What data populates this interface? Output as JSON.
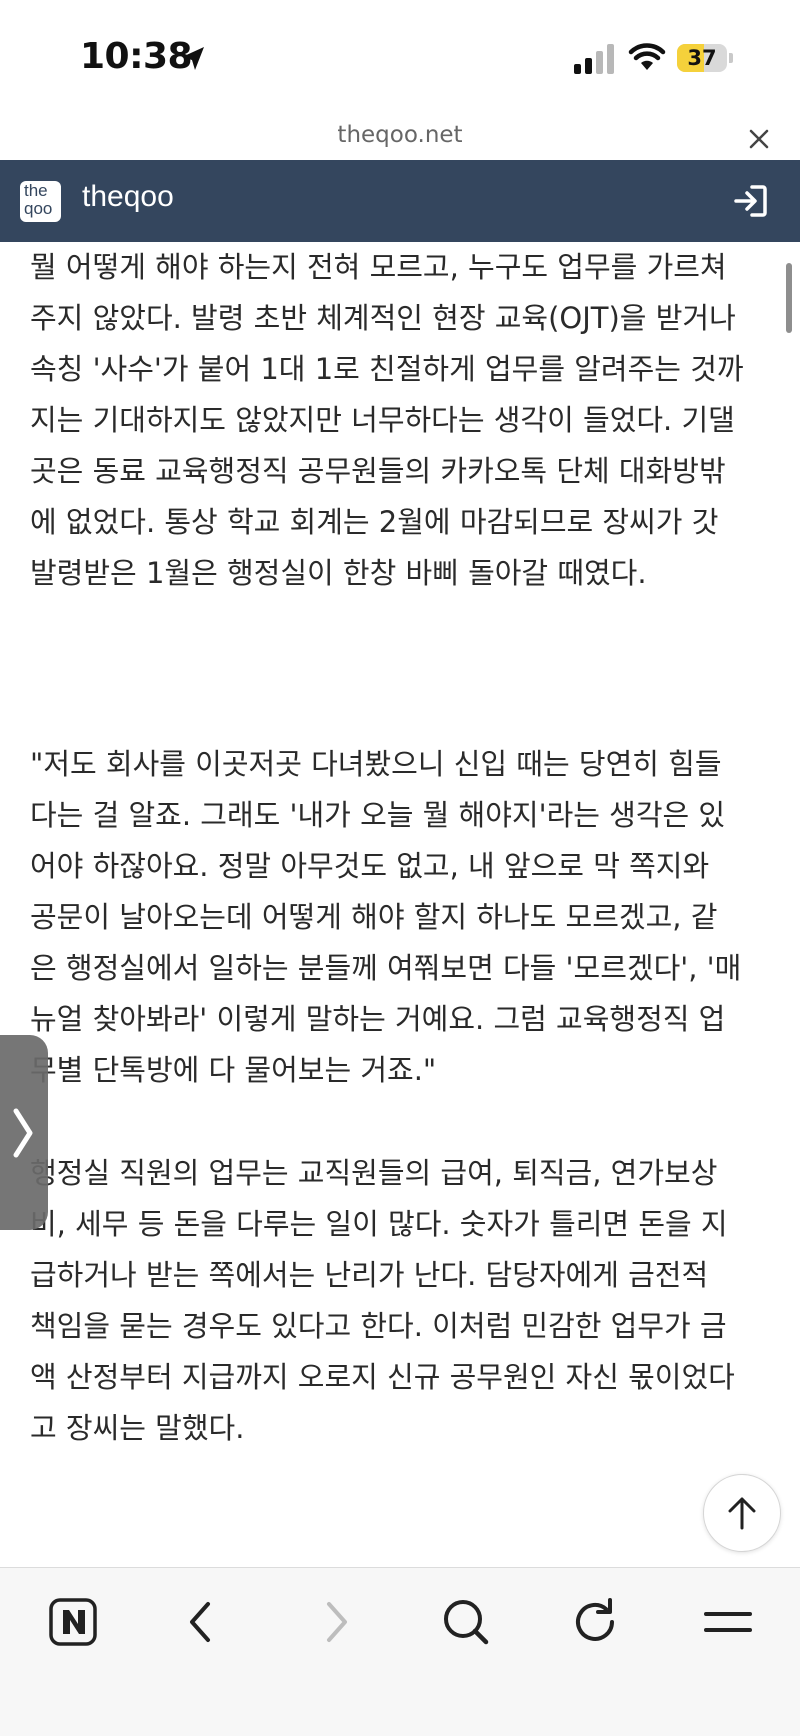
{
  "status_bar": {
    "time": "10:38",
    "battery_level": "37",
    "battery_color": "#f5d13b"
  },
  "browser": {
    "url": "theqoo.net"
  },
  "site": {
    "logo_line1": "the",
    "logo_line2": "qoo",
    "name": "theqoo",
    "header_color": "#34465e"
  },
  "article": {
    "paragraphs": [
      {
        "lines": [
          "뭘 어떻게 해야 하는지 전혀 모르고, 누구도 업무를 가르쳐",
          "주지 않았다. 발령 초반 체계적인 현장 교육(OJT)을 받거나",
          "속칭 '사수'가 붙어 1대 1로 친절하게 업무를 알려주는 것까",
          "지는 기대하지도 않았지만 너무하다는 생각이 들었다. 기댈",
          "곳은 동료 교육행정직 공무원들의 카카오톡 단체 대화방밖",
          "에 없었다. 통상 학교 회계는 2월에 마감되므로 장씨가 갓",
          "발령받은 1월은 행정실이 한창 바삐 돌아갈 때였다."
        ]
      },
      {
        "lines": [
          "\"저도 회사를 이곳저곳 다녀봤으니 신입 때는 당연히 힘들",
          "다는 걸 알죠. 그래도 '내가 오늘 뭘 해야지'라는 생각은 있",
          "어야 하잖아요. 정말 아무것도 없고, 내 앞으로 막 쪽지와",
          "공문이 날아오는데 어떻게 해야 할지 하나도 모르겠고, 같",
          "은 행정실에서 일하는 분들께 여쭤보면 다들 '모르겠다', '매",
          "뉴얼 찾아봐라' 이렇게 말하는 거예요. 그럼 교육행정직 업",
          "무별 단톡방에 다 물어보는 거죠.\""
        ]
      },
      {
        "lines": [
          "행정실 직원의 업무는 교직원들의 급여, 퇴직금, 연가보상",
          "비, 세무 등 돈을 다루는 일이 많다. 숫자가 틀리면 돈을 지",
          "급하거나 받는 쪽에서는 난리가 난다. 담당자에게 금전적",
          "책임을 묻는 경우도 있다고 한다. 이처럼 민감한 업무가 금",
          "액 산정부터 지급까지 오로지 신규 공무원인 자신 몫이었다",
          "고 장씨는 말했다."
        ]
      }
    ]
  },
  "toolbar": {
    "items": [
      {
        "icon": "naver-n-icon"
      },
      {
        "icon": "back-arrow-icon"
      },
      {
        "icon": "forward-arrow-icon",
        "disabled": true
      },
      {
        "icon": "search-icon"
      },
      {
        "icon": "reload-icon"
      },
      {
        "icon": "menu-icon"
      }
    ]
  }
}
